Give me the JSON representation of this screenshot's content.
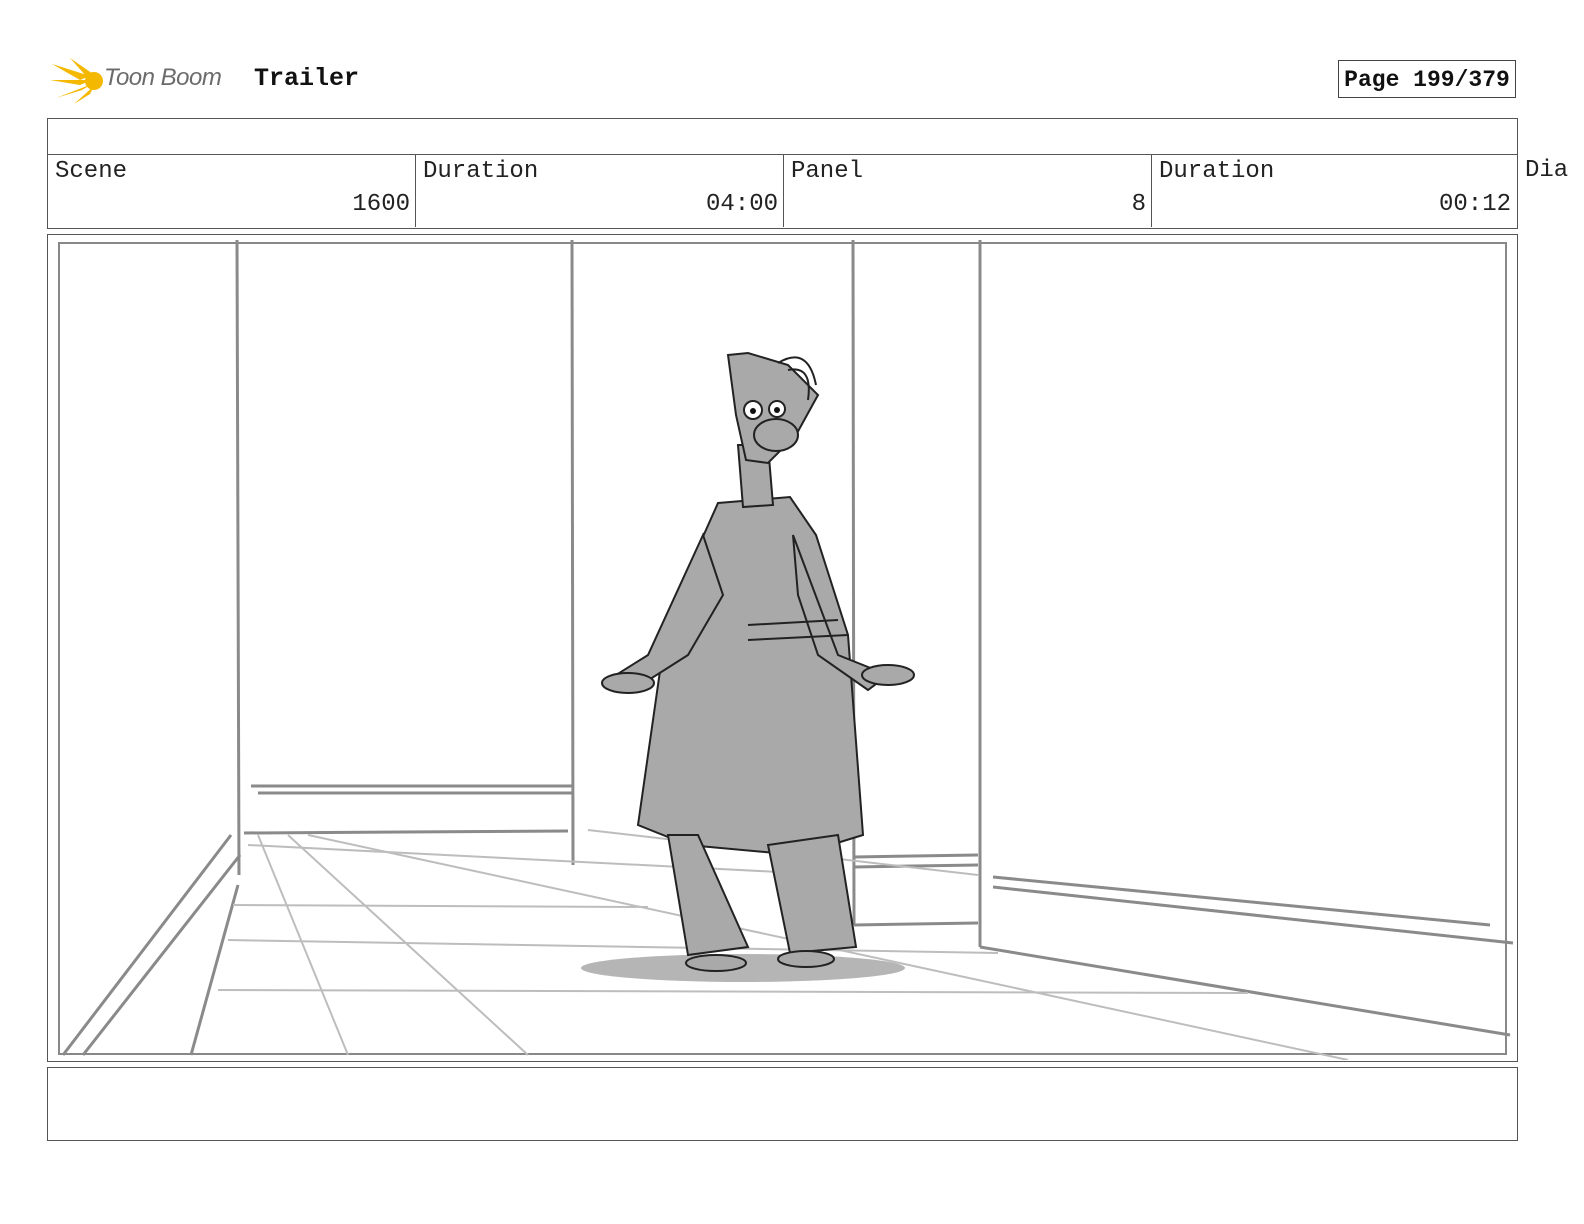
{
  "header": {
    "logo_text": "Toon Boom",
    "project_title": "Trailer",
    "page_label": "Page 199/379"
  },
  "info": {
    "scene_label": "Scene",
    "scene_value": "1600",
    "scene_duration_label": "Duration",
    "scene_duration_value": "04:00",
    "panel_label": "Panel",
    "panel_value": "8",
    "panel_duration_label": "Duration",
    "panel_duration_value": "00:12",
    "dialogue_label": "Dia"
  },
  "colors": {
    "logo_accent": "#f5b800",
    "sketch_fill": "#a9a9a9",
    "line": "#555555"
  }
}
